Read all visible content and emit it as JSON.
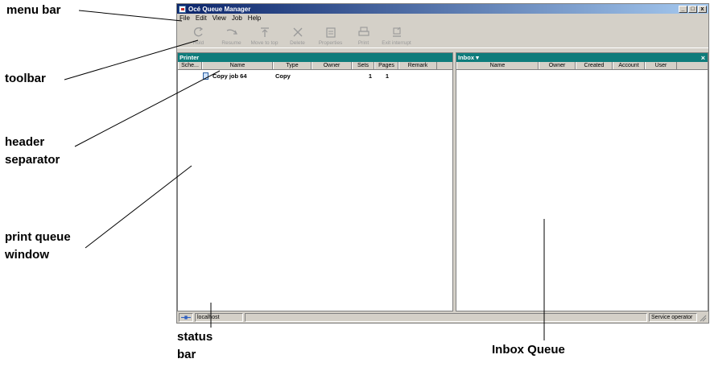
{
  "window": {
    "title": "Océ Queue Manager",
    "controls": [
      "_",
      "□",
      "x"
    ]
  },
  "menu": [
    "File",
    "Edit",
    "View",
    "Job",
    "Help"
  ],
  "toolbar": [
    {
      "label": "Hold",
      "icon": "hold-icon"
    },
    {
      "label": "Resume",
      "icon": "resume-icon"
    },
    {
      "label": "Move to top",
      "icon": "move-to-top-icon"
    },
    {
      "label": "Delete",
      "icon": "delete-icon"
    },
    {
      "label": "Properties",
      "icon": "properties-icon"
    },
    {
      "label": "Print",
      "icon": "print-icon"
    },
    {
      "label": "Exit interrupt",
      "icon": "exit-interrupt-icon"
    }
  ],
  "printer_pane": {
    "title": "Printer",
    "columns": [
      "Sche...",
      "Name",
      "Type",
      "Owner",
      "Sets",
      "Pages",
      "Remark"
    ],
    "rows": [
      {
        "name": "Copy job 64",
        "type": "Copy",
        "owner": "",
        "sets": "1",
        "pages": "1",
        "remark": ""
      }
    ]
  },
  "inbox_pane": {
    "title": "Inbox ▾",
    "close": "×",
    "columns": [
      "Name",
      "Owner",
      "Created",
      "Account",
      "User"
    ]
  },
  "statusbar": {
    "host": "localhost",
    "user": "Service operator"
  },
  "callouts": {
    "menu_bar": "menu bar",
    "toolbar": "toolbar",
    "header_separator": "header\nseparator",
    "print_queue_window": "print queue\nwindow",
    "status_bar": "status\nbar",
    "inbox_queue": "Inbox Queue"
  },
  "colors": {
    "pane_header": "#0e7c7b",
    "title_bar": "#0a246a",
    "chrome": "#d4d0c8"
  }
}
